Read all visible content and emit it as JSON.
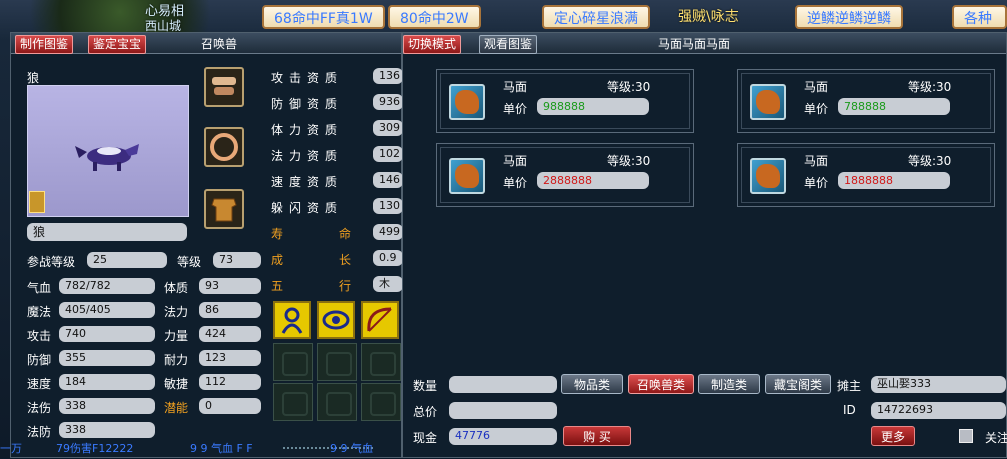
{
  "top": {
    "player_name": "心易相",
    "sub_name": "西山城",
    "tags": [
      "68命中FF真1W",
      "80命中2W",
      "定心碎星浪满"
    ],
    "title_fragment": "强贼\\咏志",
    "tags_right": [
      "逆鳞逆鳞逆鳞",
      "各种"
    ]
  },
  "left": {
    "tabs": [
      "制作图鉴",
      "鉴定宝宝"
    ],
    "title": "召唤兽",
    "pet_type": "狼",
    "pet_name": "狼",
    "aptitudes": [
      {
        "label": "攻击资质",
        "value": "136"
      },
      {
        "label": "防御资质",
        "value": "936"
      },
      {
        "label": "体力资质",
        "value": "309"
      },
      {
        "label": "法力资质",
        "value": "102"
      },
      {
        "label": "速度资质",
        "value": "146"
      },
      {
        "label": "躲闪资质",
        "value": "130"
      }
    ],
    "lifespan": {
      "label": "寿命",
      "value": "499"
    },
    "growth": {
      "label": "成长",
      "value": "0.9"
    },
    "element": {
      "label": "五行",
      "value": "木"
    },
    "battle_level": {
      "label": "参战等级",
      "value": "25"
    },
    "level": {
      "label": "等级",
      "value": "73"
    },
    "stats_left": [
      {
        "label": "气血",
        "value": "782/782"
      },
      {
        "label": "魔法",
        "value": "405/405"
      },
      {
        "label": "攻击",
        "value": "740"
      },
      {
        "label": "防御",
        "value": "355"
      },
      {
        "label": "速度",
        "value": "184"
      },
      {
        "label": "法伤",
        "value": "338"
      },
      {
        "label": "法防",
        "value": "338"
      }
    ],
    "stats_right": [
      {
        "label": "体质",
        "value": "93"
      },
      {
        "label": "法力",
        "value": "86"
      },
      {
        "label": "力量",
        "value": "424"
      },
      {
        "label": "耐力",
        "value": "123"
      },
      {
        "label": "敏捷",
        "value": "112"
      },
      {
        "label": "潜能",
        "value": "0"
      }
    ]
  },
  "right": {
    "tabs": [
      "切换模式",
      "观看图鉴"
    ],
    "title": "马面马面马面",
    "cards": [
      {
        "name": "马面",
        "level": "等级:30",
        "price_label": "单价",
        "price": "988888",
        "price_color": "#1a9a1a"
      },
      {
        "name": "马面",
        "level": "等级:30",
        "price_label": "单价",
        "price": "788888",
        "price_color": "#1a9a1a"
      },
      {
        "name": "马面",
        "level": "等级:30",
        "price_label": "单价",
        "price": "2888888",
        "price_color": "#d01818"
      },
      {
        "name": "马面",
        "level": "等级:30",
        "price_label": "单价",
        "price": "1888888",
        "price_color": "#d01818"
      }
    ],
    "quantity_label": "数量",
    "quantity_value": "",
    "total_label": "总价",
    "total_value": "",
    "cash_label": "现金",
    "cash_value": "47776",
    "buy_label": "购 买",
    "categories": [
      "物品类",
      "召唤兽类",
      "制造类",
      "藏宝阁类"
    ],
    "owner_label": "摊主",
    "owner_value": "巫山娶333",
    "id_label": "ID",
    "id_value": "14722693",
    "more_label": "更多",
    "follow_label": "关注"
  },
  "bottom_fragments": [
    "一万",
    "79伤害F12222",
    "9 9 气血 F F",
    "9 9 气血"
  ]
}
